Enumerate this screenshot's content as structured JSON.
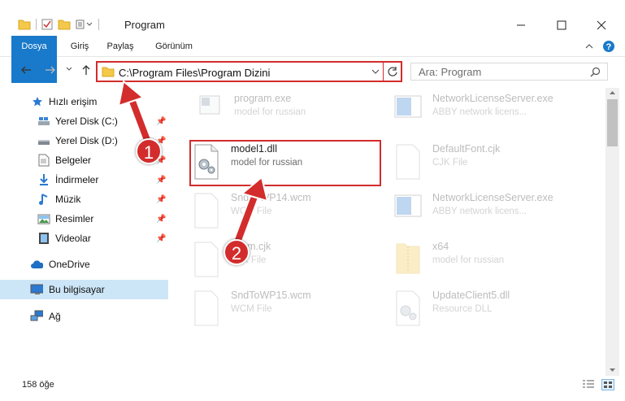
{
  "window": {
    "title": "Program",
    "minimize_icon": "minimize-icon",
    "maximize_icon": "maximize-icon",
    "close_icon": "close-icon"
  },
  "ribbon": {
    "tabs": [
      {
        "label": "Dosya"
      },
      {
        "label": "Giriş"
      },
      {
        "label": "Paylaş"
      },
      {
        "label": "Görünüm"
      }
    ],
    "accent_color": "#1979ca"
  },
  "nav": {
    "address": "C:\\Program Files\\Program Dizini",
    "search_placeholder": "Ara: Program"
  },
  "sidebar": {
    "items": [
      {
        "label": "Hızlı erişim",
        "icon": "star-icon",
        "pinned": false
      },
      {
        "label": "Yerel Disk (C:)",
        "icon": "drive-icon",
        "pinned": true
      },
      {
        "label": "Yerel Disk (D:)",
        "icon": "drive-icon",
        "pinned": true
      },
      {
        "label": "Belgeler",
        "icon": "documents-icon",
        "pinned": true
      },
      {
        "label": "İndirmeler",
        "icon": "download-icon",
        "pinned": true
      },
      {
        "label": "Müzik",
        "icon": "music-icon",
        "pinned": true
      },
      {
        "label": "Resimler",
        "icon": "pictures-icon",
        "pinned": true
      },
      {
        "label": "Videolar",
        "icon": "videos-icon",
        "pinned": true
      },
      {
        "label": "OneDrive",
        "icon": "cloud-icon",
        "pinned": false
      },
      {
        "label": "Bu bilgisayar",
        "icon": "computer-icon",
        "pinned": false,
        "selected": true
      },
      {
        "label": "Ağ",
        "icon": "network-icon",
        "pinned": false
      }
    ]
  },
  "files": [
    {
      "name": "program.exe",
      "desc": "model for russian",
      "icon": "exe-icon",
      "faded": true
    },
    {
      "name": "NetworkLicenseServer.exe",
      "desc": "ABBY network licens...",
      "icon": "app-window-icon",
      "faded": true
    },
    {
      "name": "model1.dll",
      "desc": "model for russian",
      "icon": "dll-gear-icon",
      "faded": false,
      "highlighted": true
    },
    {
      "name": "DefaultFont.cjk",
      "desc": "CJK File",
      "icon": "blank-file-icon",
      "faded": true
    },
    {
      "name": "SndToWP14.wcm",
      "desc": "WCM File",
      "icon": "blank-file-icon",
      "faded": true
    },
    {
      "name": "NetworkLicenseServer.exe",
      "desc": "ABBY network licens...",
      "icon": "app-window-icon",
      "faded": true
    },
    {
      "name": "Norm.cjk",
      "desc": "CJK File",
      "icon": "blank-file-icon",
      "faded": true
    },
    {
      "name": "x64",
      "desc": "model for russian",
      "icon": "zip-folder-icon",
      "faded": true
    },
    {
      "name": "SndToWP15.wcm",
      "desc": "WCM File",
      "icon": "blank-file-icon",
      "faded": true
    },
    {
      "name": "UpdateClient5.dll",
      "desc": "Resource DLL",
      "icon": "dll-gear-icon",
      "faded": true
    }
  ],
  "status": {
    "item_count": "158 öğe"
  },
  "callouts": [
    {
      "number": "1"
    },
    {
      "number": "2"
    }
  ],
  "highlight_color": "#d32c2c"
}
